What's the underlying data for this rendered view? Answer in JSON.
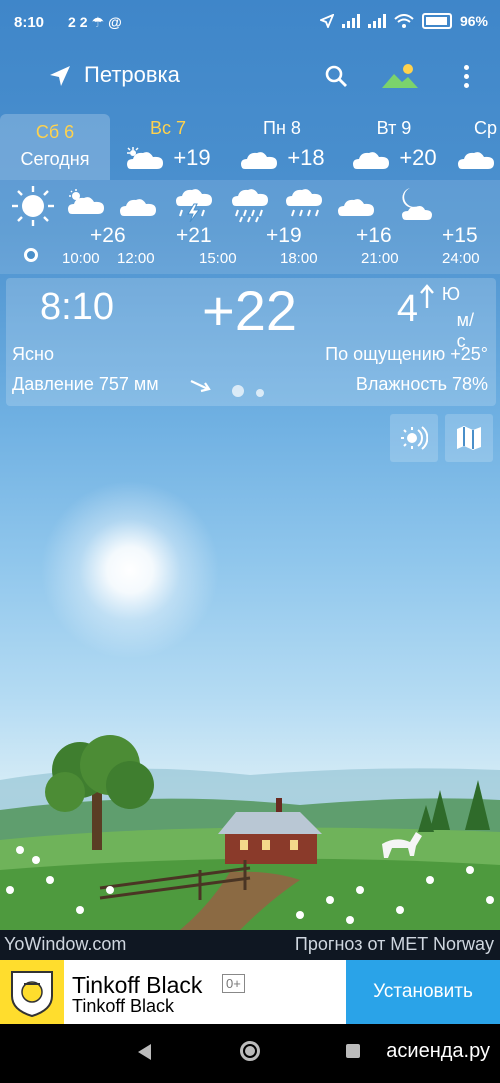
{
  "status_bar": {
    "time": "8:10",
    "temp": "22",
    "battery": "96%"
  },
  "topbar": {
    "location": "Петровка"
  },
  "days": [
    {
      "name": "Сб 6",
      "sub": "Сегодня",
      "weekend": true
    },
    {
      "name": "Вс 7",
      "temp": "+19",
      "weekend": true
    },
    {
      "name": "Пн 8",
      "temp": "+18",
      "weekend": false
    },
    {
      "name": "Вт 9",
      "temp": "+20",
      "weekend": false
    },
    {
      "name": "Ср",
      "temp": "",
      "weekend": false
    }
  ],
  "hourly": {
    "temps": [
      "+26",
      "+21",
      "+19",
      "+16",
      "+15"
    ],
    "times": [
      "10:00",
      "12:00",
      "15:00",
      "18:00",
      "21:00",
      "24:00"
    ]
  },
  "current": {
    "time": "8:10",
    "temp": "+22",
    "wind_speed": "4",
    "wind_dir": "Ю",
    "wind_unit": "м/с",
    "condition": "Ясно",
    "feels_like": "По ощущению +25°",
    "pressure": "Давление 757 мм",
    "humidity": "Влажность 78%"
  },
  "footer": {
    "brand": "YoWindow.com",
    "source": "Прогноз от MET Norway"
  },
  "ad": {
    "title": "Tinkoff Black",
    "subtitle": "Tinkoff Black",
    "age": "0+",
    "button": "Установить"
  },
  "watermark": "асиенда.ру",
  "colors": {
    "accent": "#ffd24d",
    "ad_button": "#2aa3e8",
    "ad_logo": "#ffdd2d"
  }
}
